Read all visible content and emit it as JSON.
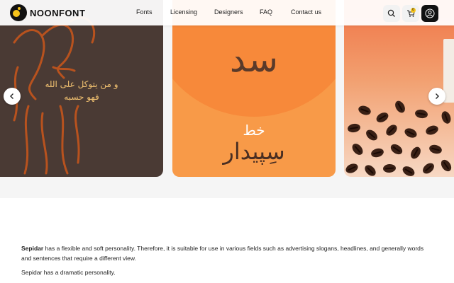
{
  "brand": {
    "name": "NOONFONT"
  },
  "nav": {
    "items": [
      "Fonts",
      "Licensing",
      "Designers",
      "FAQ",
      "Contact us"
    ]
  },
  "header_actions": {
    "search_icon": "search-icon",
    "cart_icon": "cart-icon",
    "cart_count": "0",
    "user_icon": "user-icon"
  },
  "carousel": {
    "slides": [
      {
        "quote_line1": "و من یتوکل علی الله",
        "quote_line2": "فهو حسبه"
      },
      {
        "glyph": "سد",
        "small": "خط",
        "name": "سِپیدار"
      },
      {
        "theme": "coffee beans"
      }
    ],
    "prev_icon": "chevron-left-icon",
    "next_icon": "chevron-right-icon"
  },
  "description": {
    "font_name": "Sepidar",
    "text": " has a flexible and soft personality. Therefore, it is suitable for use in various fields such as advertising slogans, headlines, and generally words and sentences that require a different view.",
    "second": "Sepidar has a dramatic personality."
  },
  "colors": {
    "accent": "#f6c31a",
    "slide1_bg": "#4a3a34",
    "slide2_bg": "#f89a48",
    "slide3_bg": "#f07446"
  }
}
